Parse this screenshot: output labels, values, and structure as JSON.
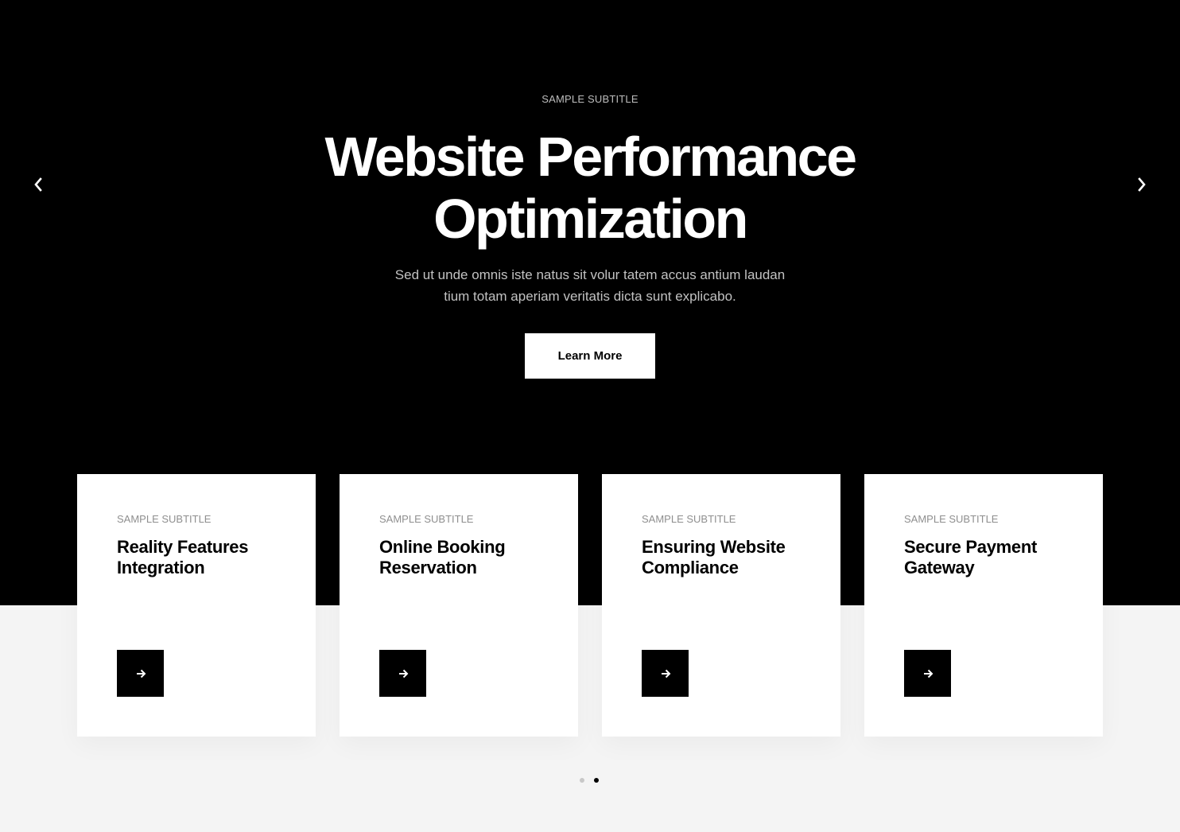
{
  "hero": {
    "subtitle": "SAMPLE SUBTITLE",
    "title_line1": "Website Performance",
    "title_line2": "Optimization",
    "description_line1": "Sed ut unde omnis iste natus sit volur tatem accus antium laudan",
    "description_line2": "tium totam aperiam veritatis dicta sunt explicabo.",
    "button_label": "Learn More",
    "prev_icon": "chevron-left-icon",
    "next_icon": "chevron-right-icon",
    "background_color": "#000000"
  },
  "cards": [
    {
      "subtitle": "SAMPLE SUBTITLE",
      "title_line1": "Reality Features",
      "title_line2": "Integration",
      "button_icon": "arrow-right-icon"
    },
    {
      "subtitle": "SAMPLE SUBTITLE",
      "title_line1": "Online Booking",
      "title_line2": "Reservation",
      "button_icon": "arrow-right-icon"
    },
    {
      "subtitle": "SAMPLE SUBTITLE",
      "title_line1": "Ensuring Website",
      "title_line2": "Compliance",
      "button_icon": "arrow-right-icon"
    },
    {
      "subtitle": "SAMPLE SUBTITLE",
      "title_line1": "Secure Payment",
      "title_line2": "Gateway",
      "button_icon": "arrow-right-icon"
    }
  ],
  "pagination": {
    "total": 2,
    "active_index": 1
  }
}
